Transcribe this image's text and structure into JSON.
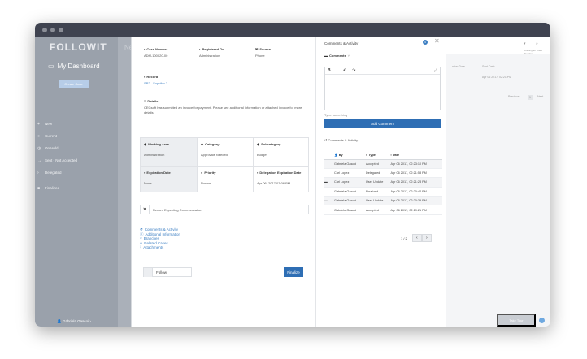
{
  "app": {
    "logo": "FOLLOWIT"
  },
  "sidebar": {
    "dashboard_label": "My Dashboard",
    "create_case": "Create Case",
    "items": [
      {
        "label": "New"
      },
      {
        "label": "Current"
      },
      {
        "label": "On Hold"
      },
      {
        "label": "Sent - Not Accepted"
      },
      {
        "label": "Delegated"
      },
      {
        "label": "Finalized"
      }
    ],
    "user": "Gabriela Gascoi"
  },
  "background": {
    "partial_title": "Ne",
    "col_date": "...ation Date",
    "col_sent": "Sent Date",
    "sent_value": "Apr 06 2017, 02:21 PM",
    "waiting": "Waiting for Case Number",
    "prev": "Previous",
    "page": "1",
    "next": "Next",
    "take_tour": "Take Tour"
  },
  "case": {
    "case_number_label": "Case Number",
    "case_number": "ADM-100020-00",
    "registered_on_label": "Registered On",
    "registered_on": "Administration",
    "source_label": "Source",
    "source": "Phone",
    "record_label": "Record",
    "record": "SP2 - Supplier 2",
    "details_label": "Details",
    "details": "CEGsoft has submitted an invoice for payment. Please see additional information or attached invoice for more details.",
    "working_area_label": "Working Area",
    "working_area": "Administration",
    "category_label": "Category",
    "category": "Approvals Needed",
    "subcategory_label": "Subcategory",
    "subcategory": "Budget",
    "expiration_label": "Expiration Date",
    "expiration": "None",
    "priority_label": "Priority",
    "priority": "Normal",
    "delegation_label": "Delegation Expiration Date",
    "delegation": "Apr 06, 2017 07:06 PM",
    "record_expecting": "Record Expecting Communication",
    "links": [
      "Comments & Activity",
      "Additional Information",
      "Branches",
      "Related Cases",
      "Attachments"
    ],
    "follow": "Follow",
    "finalize": "Finalize"
  },
  "comments_panel": {
    "title": "Comments & Activity",
    "badge": "4",
    "comments_label": "Comments",
    "editor_placeholder": "Type something",
    "add_comment": "Add Comment",
    "activity_label": "Comments & Activity",
    "columns": [
      "By",
      "Type",
      "Date"
    ],
    "rows": [
      {
        "by": "Gabriela Gascoi",
        "type": "Accepted",
        "date": "Apr 06 2017, 02:23:10 PM",
        "icon": false
      },
      {
        "by": "Carl Lopez",
        "type": "Delegated",
        "date": "Apr 06 2017, 02:21:58 PM",
        "icon": false
      },
      {
        "by": "Carl Lopez",
        "type": "User Update",
        "date": "Apr 06 2017, 02:21:28 PM",
        "icon": true
      },
      {
        "by": "Gabriela Gascoi",
        "type": "Finalized",
        "date": "Apr 06 2017, 02:20:42 PM",
        "icon": false
      },
      {
        "by": "Gabriela Gascoi",
        "type": "User Update",
        "date": "Apr 06 2017, 02:20:39 PM",
        "icon": true
      },
      {
        "by": "Gabriela Gascoi",
        "type": "Accepted",
        "date": "Apr 06 2017, 02:19:21 PM",
        "icon": false
      }
    ],
    "pager": "1 / 2"
  }
}
